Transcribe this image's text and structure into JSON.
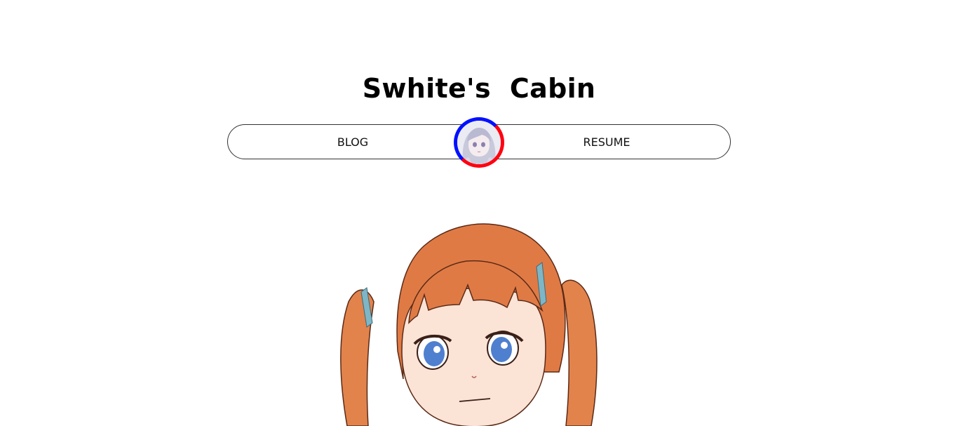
{
  "header": {
    "title": "Swhite's  Cabin"
  },
  "nav": {
    "blog_label": "BLOG",
    "resume_label": "RESUME"
  },
  "avatar": {
    "ring_colors": [
      "#ff0010",
      "#0010ff"
    ]
  },
  "colors": {
    "background": "#ffffff",
    "text": "#000000",
    "nav_border": "#333333",
    "hair": "#e07a45",
    "skin": "#fbe3d6",
    "eyes": "#4f7fcf",
    "hair_clip": "#7fb6c6"
  }
}
